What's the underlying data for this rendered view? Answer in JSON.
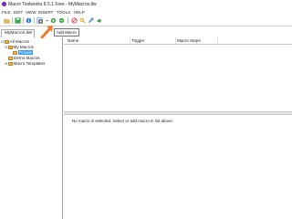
{
  "window": {
    "title": "Macro Toolworks 8.5.1 Free - MyMacros.tlw"
  },
  "menu": [
    "FILE",
    "EDIT",
    "VIEW",
    "INSERT",
    "TOOLS",
    "HELP"
  ],
  "toolbar": {
    "buttons": [
      "folder-open-icon",
      "save-icon",
      "info-icon",
      "add-macro-icon",
      "dropdown-arrow-icon",
      "add-folder-icon",
      "add-item-icon",
      "cancel-icon",
      "search-icon",
      "settings-icon",
      "hand-icon"
    ]
  },
  "tooltip": {
    "text": "Add Macro"
  },
  "tab": {
    "label": "MyMacros.tlw",
    "close": "×"
  },
  "tree": {
    "root": "All Macros",
    "my_macros": "My Macros",
    "selected_child": "Private",
    "demo": "Demo Macros",
    "templates": "Macro Templates"
  },
  "grid": {
    "columns": [
      "Name",
      "Trigger",
      "Macro Steps"
    ]
  },
  "bottom": {
    "status": "No macro is selected.  Select or add macro in list above."
  }
}
